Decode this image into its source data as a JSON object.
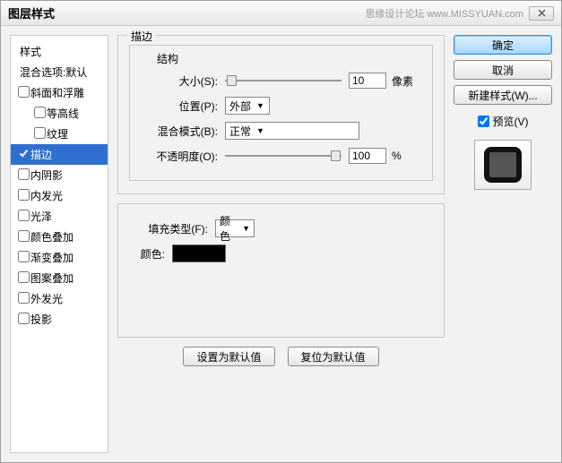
{
  "title": "图层样式",
  "watermark": "思缘设计论坛 www.MISSYUAN.com",
  "styles": {
    "header": "样式",
    "blend_defaults": "混合选项:默认",
    "items": [
      {
        "label": "斜面和浮雕",
        "checked": false,
        "sub": false
      },
      {
        "label": "等高线",
        "checked": false,
        "sub": true
      },
      {
        "label": "纹理",
        "checked": false,
        "sub": true
      },
      {
        "label": "描边",
        "checked": true,
        "sub": false,
        "selected": true
      },
      {
        "label": "内阴影",
        "checked": false,
        "sub": false
      },
      {
        "label": "内发光",
        "checked": false,
        "sub": false
      },
      {
        "label": "光泽",
        "checked": false,
        "sub": false
      },
      {
        "label": "颜色叠加",
        "checked": false,
        "sub": false
      },
      {
        "label": "渐变叠加",
        "checked": false,
        "sub": false
      },
      {
        "label": "图案叠加",
        "checked": false,
        "sub": false
      },
      {
        "label": "外发光",
        "checked": false,
        "sub": false
      },
      {
        "label": "投影",
        "checked": false,
        "sub": false
      }
    ]
  },
  "stroke": {
    "group_label": "描边",
    "structure_label": "结构",
    "size_label": "大小(S):",
    "size_value": "10",
    "size_unit": "像素",
    "position_label": "位置(P):",
    "position_value": "外部",
    "blend_label": "混合模式(B):",
    "blend_value": "正常",
    "opacity_label": "不透明度(O):",
    "opacity_value": "100",
    "opacity_unit": "%",
    "fill_group_label": "填充类型(F):",
    "fill_value": "颜色",
    "color_label": "颜色:",
    "btn_default": "设置为默认值",
    "btn_reset": "复位为默认值"
  },
  "right": {
    "ok": "确定",
    "cancel": "取消",
    "new_style": "新建样式(W)...",
    "preview": "预览(V)"
  }
}
